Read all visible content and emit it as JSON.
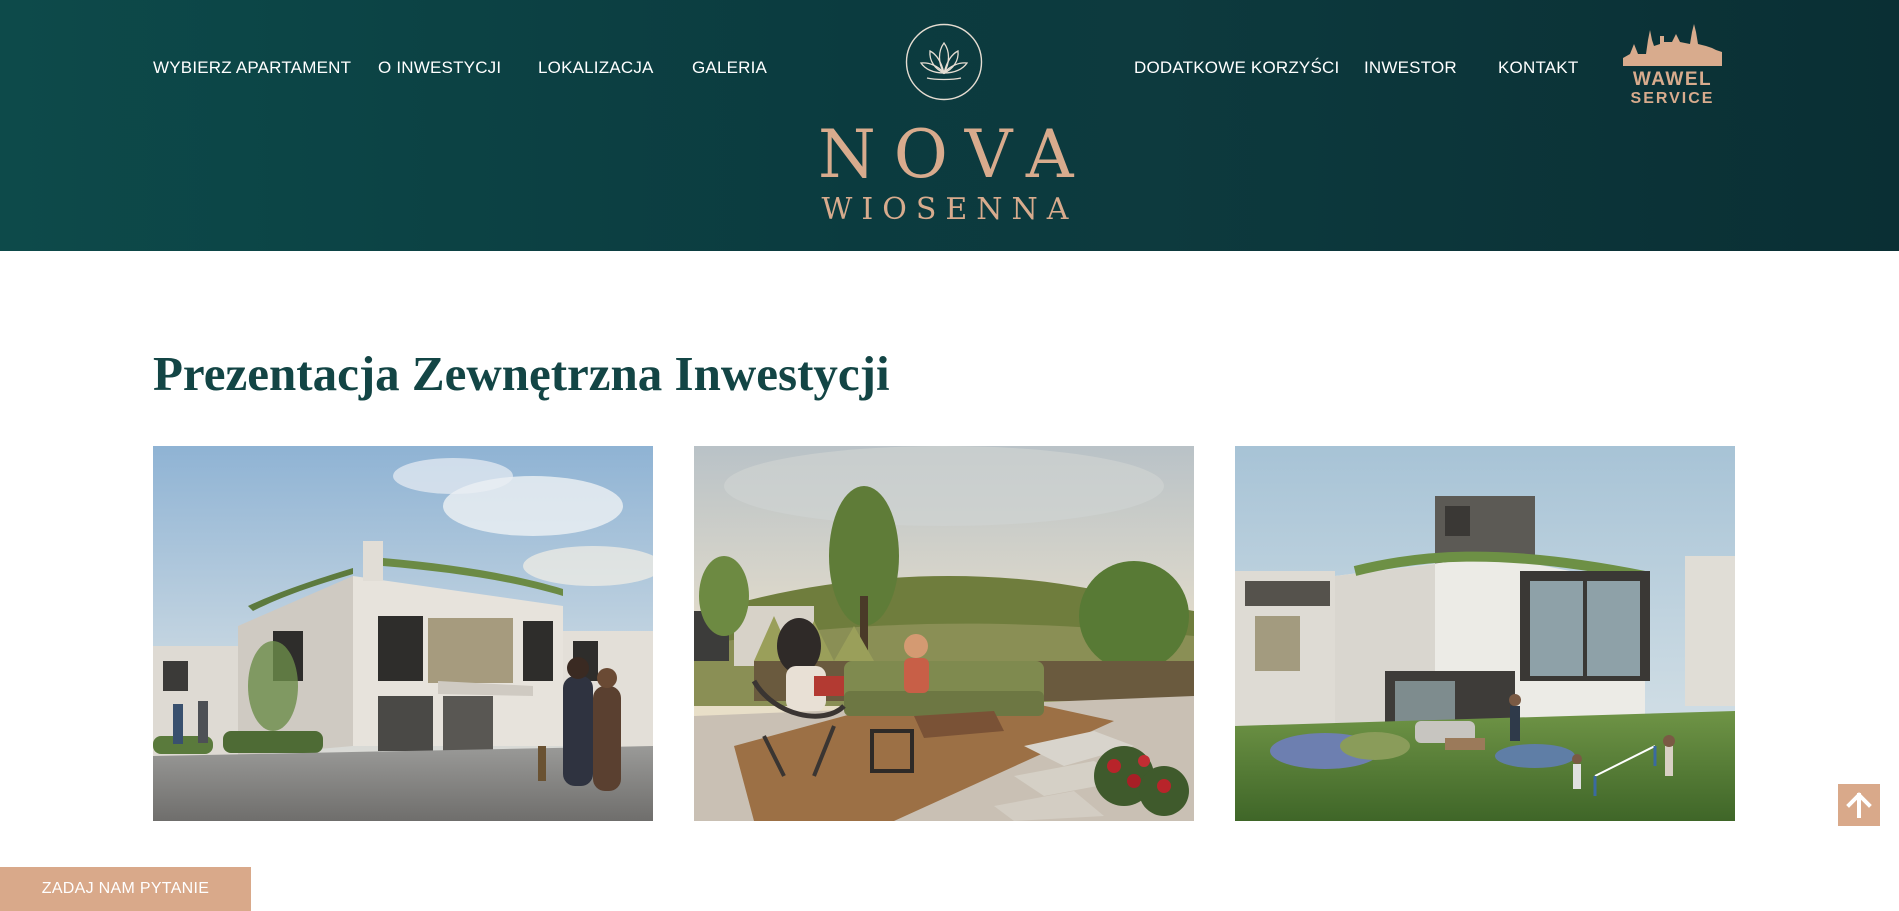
{
  "header": {
    "nav_left": [
      "WYBIERZ APARTAMENT",
      "O INWESTYCJI",
      "LOKALIZACJA",
      "GALERIA"
    ],
    "nav_right": [
      "DODATKOWE KORZYŚCI",
      "INWESTOR",
      "KONTAKT"
    ],
    "logo": {
      "line1": "NOVA",
      "line2": "WIOSENNA",
      "icon": "flower-circle-icon"
    },
    "partner": {
      "line1": "WAWEL",
      "line2": "SERVICE",
      "icon": "castle-icon"
    }
  },
  "main": {
    "title": "Prezentacja Zewnętrzna Inwestycji",
    "gallery": [
      {
        "icon": "house-street-render-image"
      },
      {
        "icon": "terrace-lounge-render-image"
      },
      {
        "icon": "garden-house-render-image"
      }
    ]
  },
  "floating": {
    "ask_label": "ZADAJ NAM PYTANIE",
    "scroll_top_icon": "arrow-up-icon"
  },
  "colors": {
    "header_bg": "#0d4a4a",
    "accent": "#d9a98a",
    "title": "#134545"
  }
}
